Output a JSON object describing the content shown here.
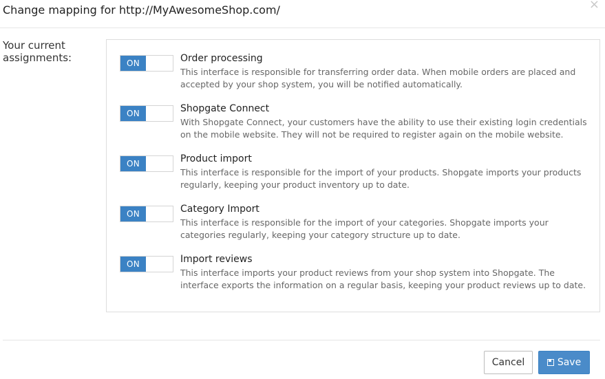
{
  "dialog": {
    "title": "Change mapping for http://MyAwesomeShop.com/",
    "close_glyph": "×",
    "side_label": "Your current assignments:"
  },
  "items": [
    {
      "toggle": "ON",
      "title": "Order processing",
      "description": "This interface is responsible for transferring order data. When mobile orders are placed and accepted by your shop system, you will be notified automatically."
    },
    {
      "toggle": "ON",
      "title": "Shopgate Connect",
      "description": "With Shopgate Connect, your customers have the ability to use their existing login credentials on the mobile website. They will not be required to register again on the mobile website."
    },
    {
      "toggle": "ON",
      "title": "Product import",
      "description": "This interface is responsible for the import of your products. Shopgate imports your products regularly, keeping your product inventory up to date."
    },
    {
      "toggle": "ON",
      "title": "Category Import",
      "description": "This interface is responsible for the import of your categories. Shopgate imports your categories regularly, keeping your category structure up to date."
    },
    {
      "toggle": "ON",
      "title": "Import reviews",
      "description": "This interface imports your product reviews from your shop system into Shopgate. The interface exports the information on a regular basis, keeping your product reviews up to date."
    }
  ],
  "footer": {
    "cancel_label": "Cancel",
    "save_label": "Save"
  },
  "colors": {
    "accent": "#3b82c4",
    "save_button": "#4a8bc9"
  },
  "icons": {
    "close": "close-icon",
    "save": "floppy-disk-icon"
  }
}
